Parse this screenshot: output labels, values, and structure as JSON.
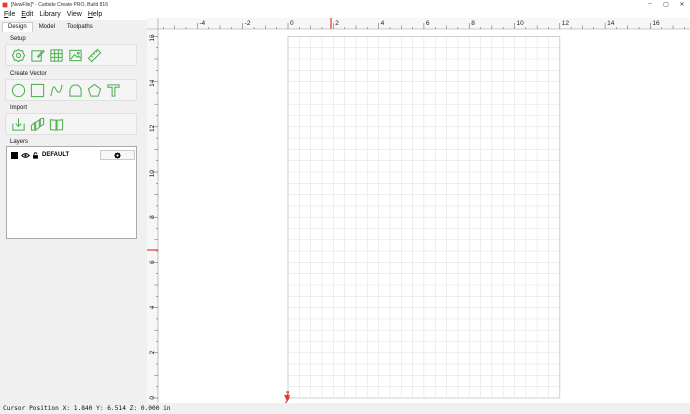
{
  "window": {
    "title": "[NewFile]* - Carbide Create PRO, Build 816"
  },
  "window_buttons": [
    "–",
    "▢",
    "✕"
  ],
  "menu": [
    {
      "label": "File",
      "mnemonic": "F",
      "rest": "ile"
    },
    {
      "label": "Edit",
      "mnemonic": "E",
      "rest": "dit"
    },
    {
      "label": "Library",
      "mnemonic": "",
      "rest": "Library"
    },
    {
      "label": "View",
      "mnemonic": "",
      "rest": "View"
    },
    {
      "label": "Help",
      "mnemonic": "H",
      "rest": "elp"
    }
  ],
  "tabs": [
    "Design",
    "Model",
    "Toolpaths"
  ],
  "sections": {
    "setup": "Setup",
    "create_vector": "Create Vector",
    "import": "Import",
    "layers": "Layers"
  },
  "icons": {
    "setup": [
      "gear-icon",
      "edit-icon",
      "grid-icon",
      "image-icon",
      "ruler-icon"
    ],
    "create_vector": [
      "circle-icon",
      "rectangle-icon",
      "curve-icon",
      "polyline-icon",
      "polygon-icon",
      "text-icon"
    ],
    "import": [
      "import-icon",
      "import-3d-icon",
      "library-icon"
    ]
  },
  "layer": {
    "name": "DEFAULT",
    "color": "#000000"
  },
  "accent_color": "#4caf50",
  "ruler": {
    "x_labels": [
      "-4",
      "-2",
      "0",
      "2",
      "4",
      "6",
      "8",
      "10",
      "12",
      "14",
      "16"
    ],
    "y_labels": [
      "16",
      "14",
      "12",
      "10",
      "8",
      "6",
      "4",
      "2",
      "0"
    ]
  },
  "status": {
    "text": "Cursor Position X: 1.840 Y: 6.514 Z: 0.000 in"
  }
}
